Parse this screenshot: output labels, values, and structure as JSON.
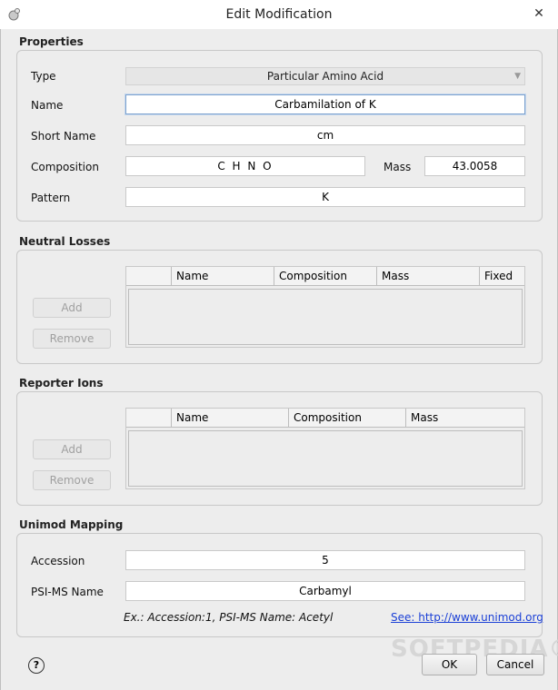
{
  "window": {
    "title": "Edit Modification",
    "close_glyph": "✕"
  },
  "properties": {
    "section_title": "Properties",
    "type_label": "Type",
    "type_value": "Particular Amino Acid",
    "name_label": "Name",
    "name_value": "Carbamilation of K",
    "short_name_label": "Short Name",
    "short_name_value": "cm",
    "composition_label": "Composition",
    "composition_value": "C H N O",
    "mass_label": "Mass",
    "mass_value": "43.0058",
    "pattern_label": "Pattern",
    "pattern_value": "K"
  },
  "neutral_losses": {
    "section_title": "Neutral Losses",
    "add_label": "Add",
    "remove_label": "Remove",
    "columns": [
      "Name",
      "Composition",
      "Mass",
      "Fixed"
    ]
  },
  "reporter_ions": {
    "section_title": "Reporter Ions",
    "add_label": "Add",
    "remove_label": "Remove",
    "columns": [
      "Name",
      "Composition",
      "Mass"
    ]
  },
  "unimod": {
    "section_title": "Unimod Mapping",
    "accession_label": "Accession",
    "accession_value": "5",
    "psims_label": "PSI-MS Name",
    "psims_value": "Carbamyl",
    "hint": "Ex.: Accession:1, PSI-MS Name: Acetyl",
    "link": "See: http://www.unimod.org"
  },
  "footer": {
    "help_glyph": "?",
    "ok_label": "OK",
    "cancel_label": "Cancel"
  },
  "watermark": "SOFTPEDIA®",
  "icons": {
    "app": "app-icon",
    "help": "help-icon",
    "dropdown": "chevron-down-icon"
  }
}
